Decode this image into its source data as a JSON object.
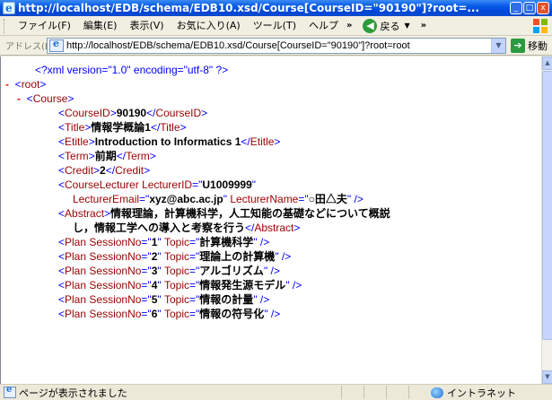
{
  "window": {
    "title": "http://localhost/EDB/schema/EDB10.xsd/Course[CourseID=\"90190\"]?root=...",
    "controls": {
      "minimize": "_",
      "maximize": "□",
      "close": "x"
    }
  },
  "menu": {
    "items": [
      "ファイル(F)",
      "編集(E)",
      "表示(V)",
      "お気に入り(A)",
      "ツール(T)",
      "ヘルプ"
    ],
    "chevron": "»",
    "back_label": "戻る",
    "chevron2": "»"
  },
  "address": {
    "label": "アドレス(D)",
    "url": "http://localhost/EDB/schema/EDB10.xsd/Course[CourseID=\"90190\"]?root=root",
    "go_label": "移動"
  },
  "xml": {
    "declaration": "<?xml version=\"1.0\" encoding=\"utf-8\" ?>",
    "root_tag": "root",
    "course_tag": "Course",
    "course_id": {
      "tag": "CourseID",
      "value": "90190"
    },
    "title": {
      "tag": "Title",
      "value": "情報学概論1"
    },
    "etitle": {
      "tag": "Etitle",
      "value": "Introduction to Informatics 1"
    },
    "term": {
      "tag": "Term",
      "value": "前期"
    },
    "credit": {
      "tag": "Credit",
      "value": "2"
    },
    "lecturer": {
      "tag": "CourseLecturer",
      "id_attr": "LecturerID",
      "id_value": "U1009999",
      "email_attr": "LecturerEmail",
      "email_value": "xyz@abc.ac.jp",
      "name_attr": "LecturerName",
      "name_value": "○田△夫"
    },
    "abstract": {
      "tag": "Abstract",
      "line1": "情報理論，計算機科学，人工知能の基礎などについて概説",
      "line2": "し，情報工学への導入と考察を行う"
    },
    "plans": [
      {
        "session": "1",
        "topic": "計算機科学"
      },
      {
        "session": "2",
        "topic": "理論上の計算機"
      },
      {
        "session": "3",
        "topic": "アルゴリズム"
      },
      {
        "session": "4",
        "topic": "情報発生源モデル"
      },
      {
        "session": "5",
        "topic": "情報の計量"
      },
      {
        "session": "6",
        "topic": "情報の符号化"
      }
    ]
  },
  "status": {
    "text": "ページが表示されました",
    "zone": "イントラネット"
  }
}
